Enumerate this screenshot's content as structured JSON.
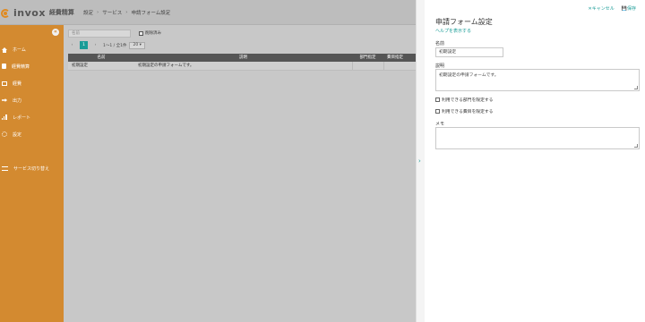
{
  "header": {
    "logo_text": "invox",
    "logo_sub": "経費精算",
    "breadcrumb": [
      "設定",
      "サービス",
      "申請フォーム設定"
    ],
    "breadcrumb_sep": "›"
  },
  "sidebar": {
    "items": [
      {
        "label": "ホーム",
        "icon": "home-icon"
      },
      {
        "label": "経費精算",
        "icon": "document-icon"
      },
      {
        "label": "経費",
        "icon": "box-icon"
      },
      {
        "label": "出力",
        "icon": "export-icon"
      },
      {
        "label": "レポート",
        "icon": "chart-icon"
      },
      {
        "label": "設定",
        "icon": "gear-icon"
      },
      {
        "label": "サービス切り替え",
        "icon": "switch-icon"
      }
    ],
    "collapse_glyph": "«",
    "accent": "#d38a30"
  },
  "list": {
    "search_placeholder": "名前",
    "deleted_label": "削除済み",
    "pager": {
      "prev": "‹",
      "current": "1",
      "next": "›",
      "range": "1〜1 / 全1件",
      "page_size": "20 ▾"
    },
    "columns": [
      "名前",
      "説明",
      "部門指定",
      "費目指定"
    ],
    "rows": [
      {
        "name": "初期設定",
        "description": "初期設定の申請フォームです。",
        "dept": "",
        "item": ""
      }
    ]
  },
  "panel": {
    "cancel_label": "キャンセル",
    "save_label": "保存",
    "title": "申請フォーム設定",
    "help_link": "ヘルプを表示する",
    "name_label": "名前",
    "name_value": "初期設定",
    "description_label": "説明",
    "description_value": "初期設定の申請フォームです。",
    "dept_option": "利用できる部門を限定する",
    "item_option": "利用できる費目を限定する",
    "memo_label": "メモ",
    "memo_value": "",
    "accent": "#1a9c97"
  },
  "splitter_glyph": "›"
}
